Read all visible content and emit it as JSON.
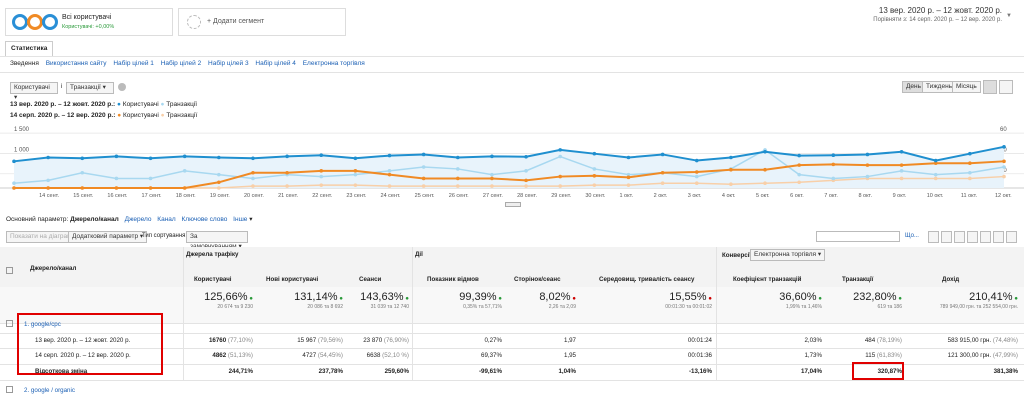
{
  "segment": {
    "name": "Всі користувачі",
    "sub": "Користувачі: +0,00%",
    "add": "+ Додати сегмент"
  },
  "daterange": {
    "main": "13 вер. 2020 р. – 12 жовт. 2020 р.",
    "compare": "Порівняти з: 14 серп. 2020 р. – 12 вер. 2020 р."
  },
  "tab": "Статистика",
  "subtabs": [
    "Зведення",
    "Використання сайту",
    "Набір цілей 1",
    "Набір цілей 2",
    "Набір цілей 3",
    "Набір цілей 4",
    "Електронна торгівля"
  ],
  "metric_select": {
    "m1": "Користувачі",
    "vs": "і",
    "m2": "Транзакції"
  },
  "period_buttons": [
    "День",
    "Тиждень",
    "Місяць"
  ],
  "legend": {
    "p1": "13 вер. 2020 р. – 12 жовт. 2020 р.:",
    "p2": "14 серп. 2020 р. – 12 вер. 2020 р.:",
    "users": "Користувачі",
    "tx": "Транзакції"
  },
  "colors": {
    "users1": "#1f8fcf",
    "tx1": "#a8d8f0",
    "users2": "#f08a24",
    "tx2": "#f8cfa8",
    "accent": "#1a5fb4",
    "highlight": "#e00000"
  },
  "chart_data": {
    "type": "line",
    "x": [
      "14 сент.",
      "15 сент.",
      "16 сент.",
      "17 сент.",
      "18 сент.",
      "19 сент.",
      "20 сент.",
      "21 сент.",
      "22 сент.",
      "23 сент.",
      "24 сент.",
      "25 сент.",
      "26 сент.",
      "27 сент.",
      "28 сент.",
      "29 сент.",
      "30 сент.",
      "1 окт.",
      "2 окт.",
      "3 окт.",
      "4 окт.",
      "5 окт.",
      "6 окт.",
      "7 окт.",
      "8 окт.",
      "9 окт.",
      "10 окт.",
      "11 окт.",
      "12 окт."
    ],
    "yticks_left": [
      "1 500",
      "1 000",
      "500"
    ],
    "yticks_right": [
      "60",
      "40",
      "20"
    ],
    "series": [
      {
        "name": "Користувачі",
        "values": [
          700,
          800,
          780,
          830,
          780,
          830,
          800,
          780,
          830,
          860,
          780,
          850,
          880,
          800,
          830,
          820,
          1000,
          900,
          800,
          880,
          720,
          800,
          950,
          850,
          860,
          880,
          950,
          720,
          900,
          1080
        ],
        "axis": "left"
      },
      {
        "name": "Транзакції",
        "values": [
          5,
          8,
          16,
          10,
          10,
          18,
          14,
          10,
          14,
          12,
          14,
          18,
          22,
          20,
          14,
          18,
          33,
          20,
          14,
          16,
          12,
          20,
          40,
          14,
          10,
          12,
          18,
          14,
          16,
          22
        ],
        "axis": "right"
      },
      {
        "name": "Користувачі (14 серп. – 12 вер.)",
        "values": [
          0,
          0,
          0,
          0,
          0,
          0,
          150,
          400,
          400,
          450,
          450,
          350,
          250,
          250,
          250,
          200,
          300,
          320,
          280,
          400,
          420,
          480,
          480,
          600,
          620,
          600,
          600,
          650,
          650,
          700
        ],
        "axis": "left"
      },
      {
        "name": "Транзакції (14 серп. – 12 вер.)",
        "values": [
          0,
          0,
          0,
          0,
          0,
          0,
          0,
          2,
          2,
          3,
          3,
          2,
          2,
          2,
          2,
          2,
          2,
          3,
          3,
          5,
          5,
          4,
          5,
          6,
          8,
          10,
          10,
          10,
          10,
          12
        ],
        "axis": "right"
      }
    ],
    "ylim_left": [
      0,
      1600
    ],
    "ylim_right": [
      0,
      64
    ]
  },
  "dims": {
    "label": "Основний параметр:",
    "active": "Джерело/канал",
    "others": [
      "Джерело",
      "Канал",
      "Ключове слово",
      "Інше"
    ]
  },
  "toolbar": {
    "plot": "Показати на діаграмі",
    "secondary": "Додатковий параметр",
    "sort_label": "Тип сортування:",
    "sort": "За замовчуванням"
  },
  "table": {
    "groups": {
      "acq": "Джерела трафіку",
      "beh": "Дії",
      "conv": "Конверсії",
      "conv_sel": "Електронна торгівля"
    },
    "cols": [
      "Джерело/канал",
      "Користувачі",
      "Нові користувачі",
      "Сеанси",
      "Показник відмов",
      "Сторінок/сеанс",
      "Середовищ. тривалість сеансу",
      "Коефіцієнт транзакцій",
      "Транзакції",
      "Дохід"
    ],
    "totals": {
      "users": {
        "v": "125,66%",
        "s": "20 674 та 9 230"
      },
      "new": {
        "v": "131,14%",
        "s": "20 086 та 8 692"
      },
      "sessions": {
        "v": "143,63%",
        "s": "31 039 та 12 740"
      },
      "bounce": {
        "v": "99,39%",
        "s": "0,35% та 57,71%"
      },
      "pages": {
        "v": "8,02%",
        "s": "2,26 та 2,09"
      },
      "dur": {
        "v": "15,55%",
        "s": "00:01:30 та 00:01:02"
      },
      "conv": {
        "v": "36,60%",
        "s": "1,99% та 1,46%"
      },
      "tx": {
        "v": "232,80%",
        "s": "619 та 186"
      },
      "rev": {
        "v": "210,41%",
        "s": "789 949,00 грн. та 252 554,00 грн."
      }
    },
    "rows": [
      {
        "idx": "1.",
        "name": "google/cpc"
      },
      {
        "name": "13 вер. 2020 р. – 12 жовт. 2020 р.",
        "users": "16760",
        "users_p": "(77,10%)",
        "new": "15 967",
        "new_p": "(79,56%)",
        "sessions": "23 870",
        "sessions_p": "(76,90%)",
        "bounce": "0,27%",
        "pages": "1,97",
        "dur": "00:01:24",
        "conv": "2,03%",
        "tx": "484",
        "tx_p": "(78,19%)",
        "rev": "583 915,00 грн.",
        "rev_p": "(74,48%)"
      },
      {
        "name": "14 серп. 2020 р. – 12 вер. 2020 р.",
        "users": "4862",
        "users_p": "(51,13%)",
        "new": "4727",
        "new_p": "(54,45%)",
        "sessions": "6638",
        "sessions_p": "(52,10 %)",
        "bounce": "69,37%",
        "pages": "1,95",
        "dur": "00:01:36",
        "conv": "1,73%",
        "tx": "115",
        "tx_p": "(61,83%)",
        "rev": "121 300,00 грн.",
        "rev_p": "(47,99%)"
      },
      {
        "name": "Відсоткова зміна",
        "users": "244,71%",
        "new": "237,78%",
        "sessions": "259,60%",
        "bounce": "-99,61%",
        "pages": "1,04%",
        "dur": "-13,16%",
        "conv": "17,04%",
        "tx": "320,87%",
        "rev": "381,38%"
      },
      {
        "idx": "2.",
        "name": "google / organic"
      }
    ]
  }
}
